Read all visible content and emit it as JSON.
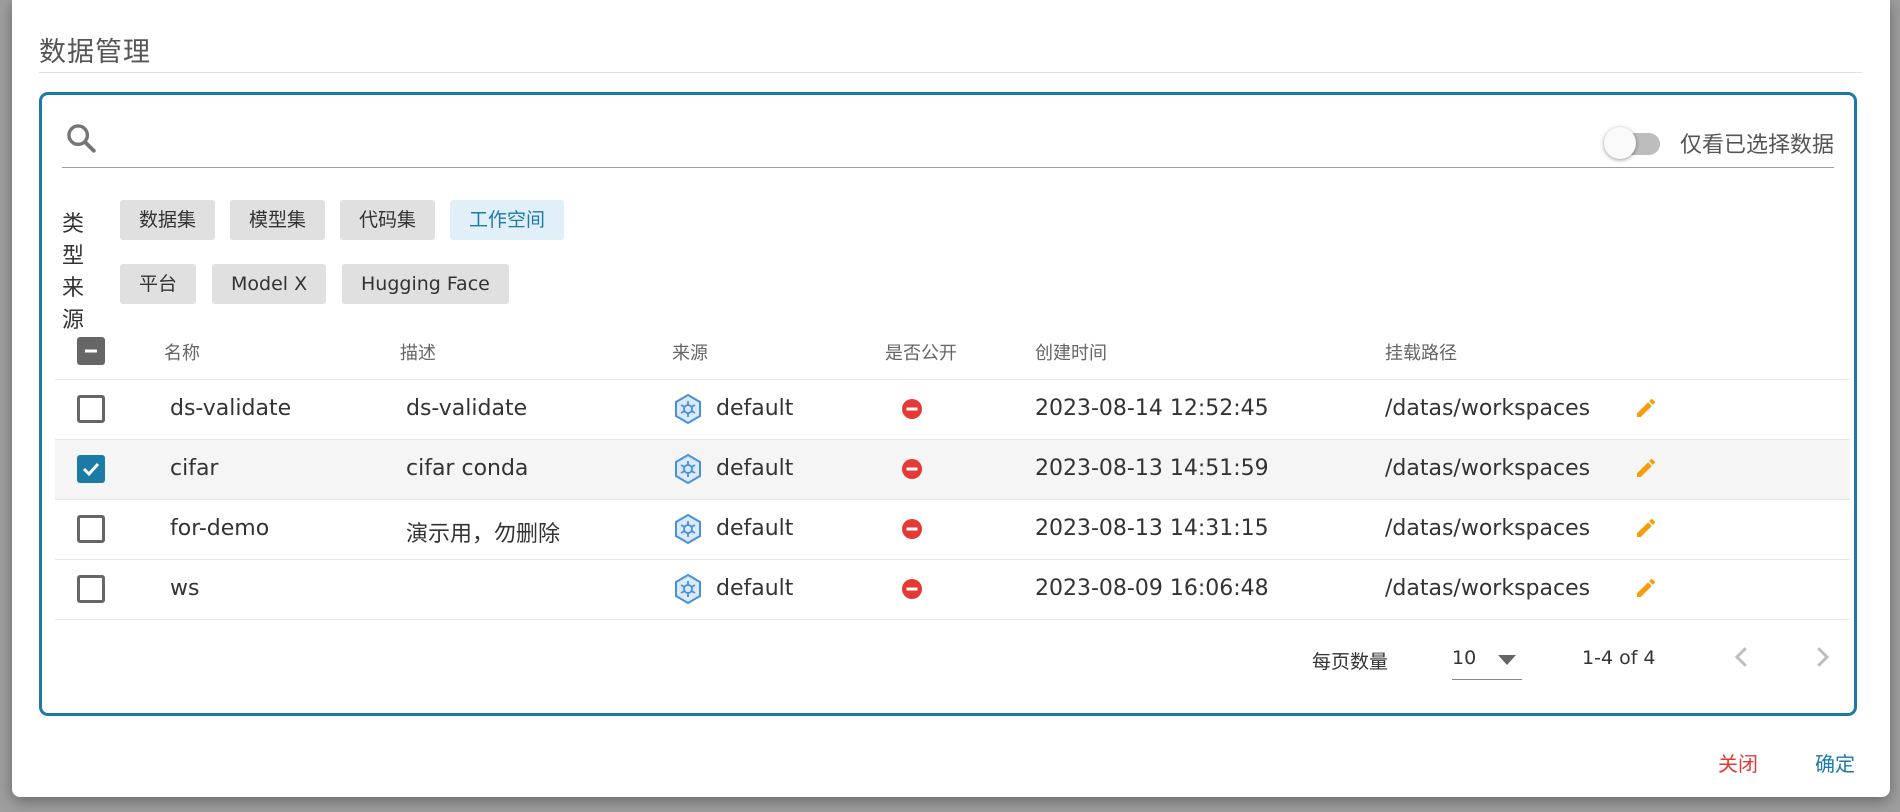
{
  "dialog": {
    "title": "数据管理"
  },
  "search": {
    "value": "",
    "placeholder": ""
  },
  "toggle": {
    "label": "仅看已选择数据",
    "on": false
  },
  "filters": {
    "type": {
      "label": "类型",
      "chips": [
        "数据集",
        "模型集",
        "代码集",
        "工作空间"
      ],
      "active": "工作空间"
    },
    "source": {
      "label": "来源",
      "chips": [
        "平台",
        "Model X",
        "Hugging Face"
      ]
    }
  },
  "table": {
    "columns": [
      "名称",
      "描述",
      "来源",
      "是否公开",
      "创建时间",
      "挂载路径"
    ],
    "rows": [
      {
        "name": "ds-validate",
        "description": "ds-validate",
        "source": "default",
        "public": false,
        "created": "2023-08-14 12:52:45",
        "path": "/datas/workspaces",
        "checked": false
      },
      {
        "name": "cifar",
        "description": "cifar conda",
        "source": "default",
        "public": false,
        "created": "2023-08-13 14:51:59",
        "path": "/datas/workspaces",
        "checked": true
      },
      {
        "name": "for-demo",
        "description": "演示用，勿删除",
        "source": "default",
        "public": false,
        "created": "2023-08-13 14:31:15",
        "path": "/datas/workspaces",
        "checked": false
      },
      {
        "name": "ws",
        "description": "",
        "source": "default",
        "public": false,
        "created": "2023-08-09 16:06:48",
        "path": "/datas/workspaces",
        "checked": false
      }
    ]
  },
  "pagination": {
    "per_page_label": "每页数量",
    "per_page": "10",
    "range": "1-4 of 4"
  },
  "actions": {
    "close": "关闭",
    "confirm": "确定"
  },
  "colors": {
    "accent": "#1b7aa6",
    "danger": "#e53935",
    "edit": "#f59e0b",
    "source_icon": "#4a90d9"
  },
  "icons": {
    "search": "search-icon",
    "source": "kubernetes-icon",
    "not_public": "minus-circle-icon",
    "edit": "pencil-icon",
    "caret": "caret-down-icon",
    "prev": "chevron-left-icon",
    "next": "chevron-right-icon"
  }
}
